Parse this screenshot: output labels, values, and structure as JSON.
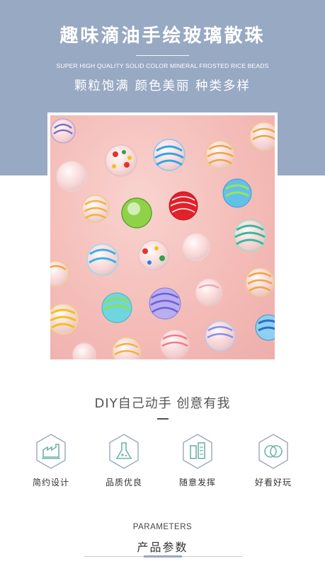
{
  "header": {
    "title": "趣味滴油手绘玻璃散珠",
    "subtitle_en": "SUPER HIGH QUALITY SOLID COLOR MINERAL FROSTED RICE BEADS",
    "tagline": "颗粒饱满 颜色美丽 种类多样",
    "background_color": "#98a9c3"
  },
  "slogan": "DIY自己动手 创意有我",
  "features": [
    {
      "icon": "factory-icon",
      "label": "简约设计"
    },
    {
      "icon": "flask-icon",
      "label": "品质优良"
    },
    {
      "icon": "tools-icon",
      "label": "随意发挥"
    },
    {
      "icon": "overlapping-circles-icon",
      "label": "好看好玩"
    }
  ],
  "parameters": {
    "title_en": "PARAMETERS",
    "title_cn": "产品参数"
  },
  "colors": {
    "accent": "#98a9c3",
    "icon_teal": "#6fb3a9",
    "photo_pink": "#f4bcb8"
  }
}
